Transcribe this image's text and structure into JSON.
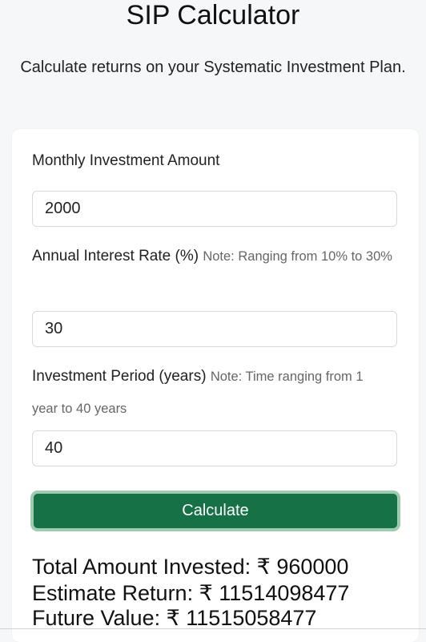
{
  "header": {
    "title": "SIP Calculator",
    "subtitle": "Calculate returns on your Systematic Investment Plan."
  },
  "form": {
    "monthly": {
      "label": "Monthly Investment Amount",
      "value": "2000"
    },
    "rate": {
      "label": "Annual Interest Rate (%)",
      "note": "Note: Ranging from 10% to 30%",
      "value": "30"
    },
    "period": {
      "label": "Investment Period (years)",
      "note": "Note: Time ranging from 1 year to 40 years",
      "value": "40"
    },
    "calculate_label": "Calculate"
  },
  "results": {
    "total_invested": "Total Amount Invested: ₹ 960000",
    "estimate_return": "Estimate Return: ₹ 11514098477",
    "future_value": "Future Value: ₹ 11515058477"
  },
  "colors": {
    "button_bg": "#177146",
    "button_border": "#9fcbb1",
    "page_bg": "#f6f7f9"
  }
}
